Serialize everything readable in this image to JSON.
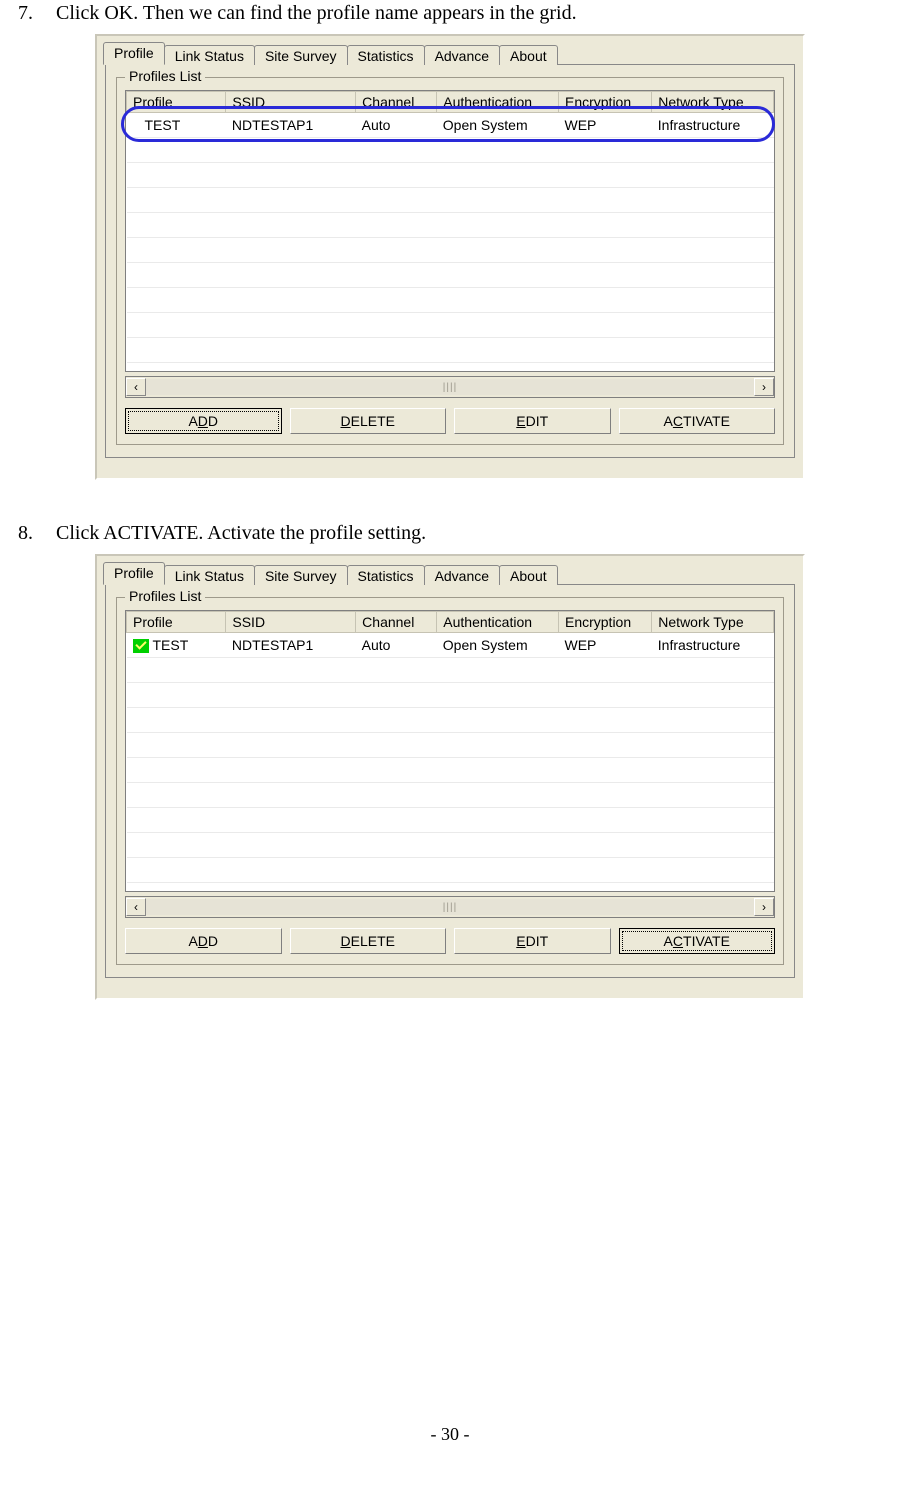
{
  "steps": [
    {
      "num": "7.",
      "text": "Click OK. Then we can find the profile name appears in the grid."
    },
    {
      "num": "8.",
      "text": "Click ACTIVATE. Activate the profile setting."
    }
  ],
  "tabs": [
    "Profile",
    "Link Status",
    "Site Survey",
    "Statistics",
    "Advance",
    "About"
  ],
  "groupbox_title": "Profiles List",
  "columns": [
    "Profile",
    "SSID",
    "Channel",
    "Authentication",
    "Encryption",
    "Network Type"
  ],
  "row": {
    "profile": "TEST",
    "ssid": "NDTESTAP1",
    "channel": "Auto",
    "auth": "Open System",
    "enc": "WEP",
    "nettype": "Infrastructure"
  },
  "buttons": {
    "add_pre": "A",
    "add_u": "D",
    "add_post": "D",
    "del_pre": "",
    "del_u": "D",
    "del_post": "ELETE",
    "edit_pre": "",
    "edit_u": "E",
    "edit_post": "DIT",
    "act_pre": "A",
    "act_u": "C",
    "act_post": "TIVATE"
  },
  "page_number": "- 30 -",
  "scroll_glyph": "||||"
}
